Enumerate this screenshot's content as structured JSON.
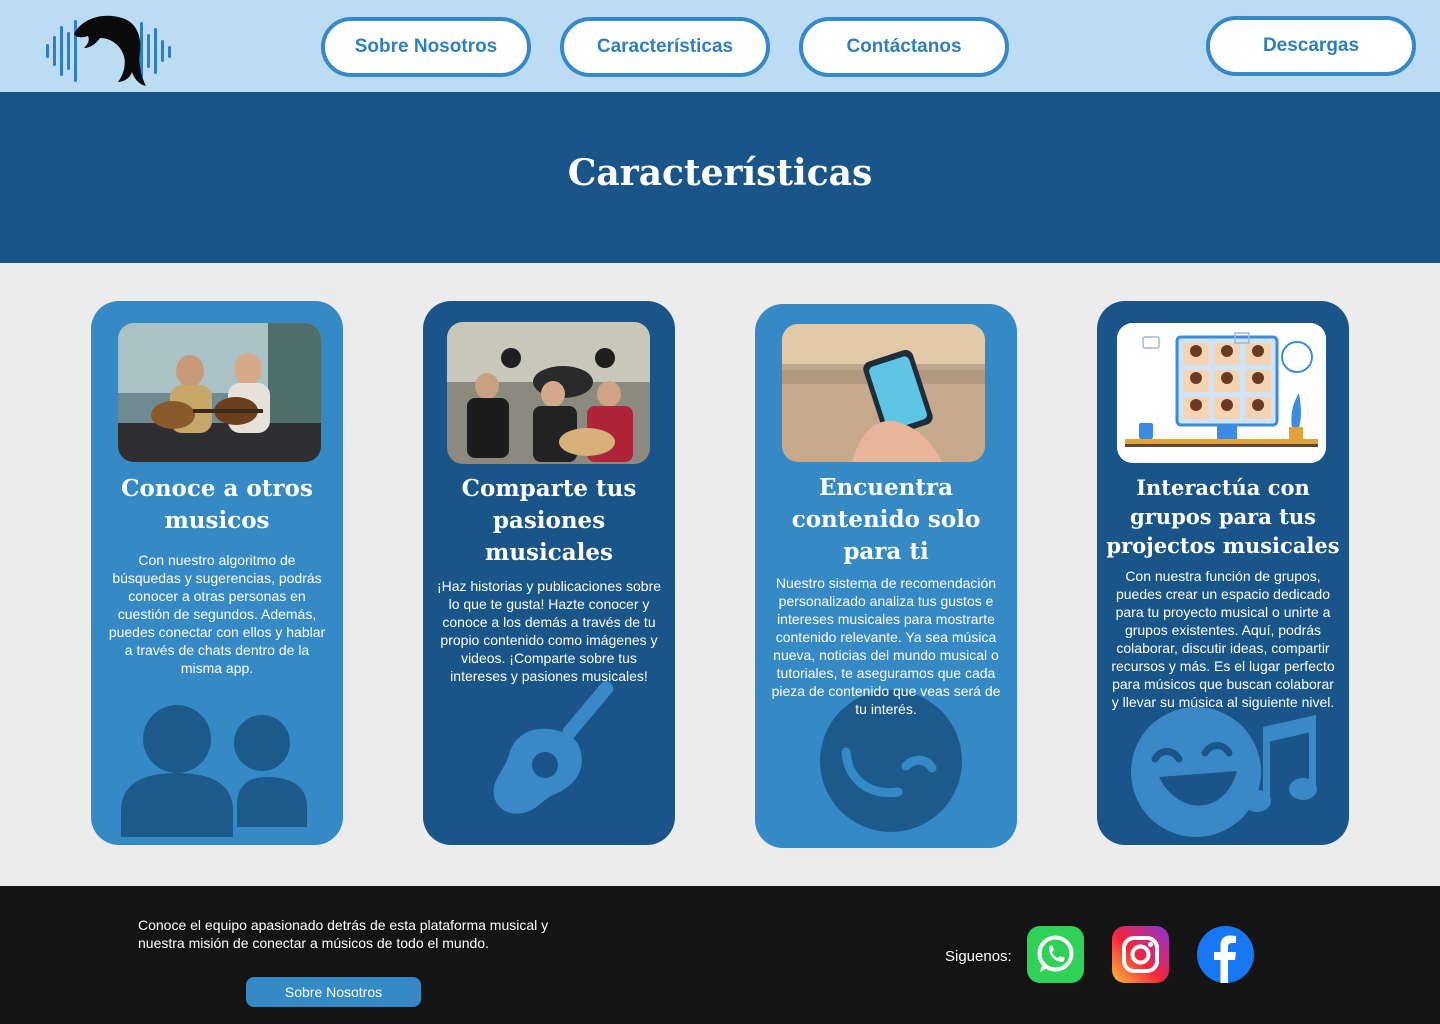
{
  "nav": {
    "logo_icon": "dolphin-soundwave-logo",
    "links": [
      "Sobre Nosotros",
      "Características",
      "Contáctanos"
    ],
    "download": "Descargas"
  },
  "hero": {
    "title": "Características"
  },
  "cards": [
    {
      "title_lines": [
        "Conoce a otros",
        "musicos"
      ],
      "text": "Con nuestro algoritmo de búsquedas y sugerencias, podrás conocer a otras personas en cuestión de segundos. Además, puedes conectar con ellos y hablar a través de chats dentro de la misma app.",
      "image": "two-men-playing-guitars-photo",
      "icon": "users-icon"
    },
    {
      "title_lines": [
        "Comparte tus",
        "pasiones",
        "musicales"
      ],
      "text": "¡Haz historias y publicaciones sobre lo que te gusta! Hazte conocer y conoce a los demás a través de tu propio contenido como imágenes y videos. ¡Comparte sobre tus intereses y pasiones musicales!",
      "image": "rock-band-photo",
      "icon": "guitar-icon"
    },
    {
      "title_lines": [
        "Encuentra",
        "contenido solo",
        "para ti"
      ],
      "text": "Nuestro sistema de recomendación personalizado analiza tus gustos e intereses musicales para mostrarte contenido relevante. Ya sea música nueva, noticias del mundo musical o tutoriales, te aseguramos que cada pieza de contenido que veas será de tu interés.",
      "image": "hand-holding-phone-photo",
      "icon": "wink-face-icon"
    },
    {
      "title_lines": [
        "Interactúa con",
        "grupos para tus",
        "projectos musicales"
      ],
      "text": "Con nuestra función de grupos, puedes crear un espacio dedicado para tu proyecto musical o unirte a grupos existentes. Aquí, podrás colaborar, discutir ideas, compartir recursos y más. Es el lugar perfecto para músicos que buscan colaborar y llevar su música al siguiente nivel.",
      "image": "video-call-group-illustration",
      "icon": "singing-face-music-icon"
    }
  ],
  "footer": {
    "text": "Conoce el equipo apasionado detrás de esta plataforma musical y nuestra misión de conectar a músicos de todo el mundo.",
    "button": "Sobre Nosotros",
    "follow_label": "Siguenos:",
    "social_icons": [
      "whatsapp-icon",
      "instagram-icon",
      "facebook-icon"
    ]
  },
  "colors": {
    "nav_bg": "#bcdcf4",
    "accent": "#3589c4",
    "dark_blue": "#1a5589",
    "page_bg": "#ececec",
    "footer_bg": "#141414"
  }
}
